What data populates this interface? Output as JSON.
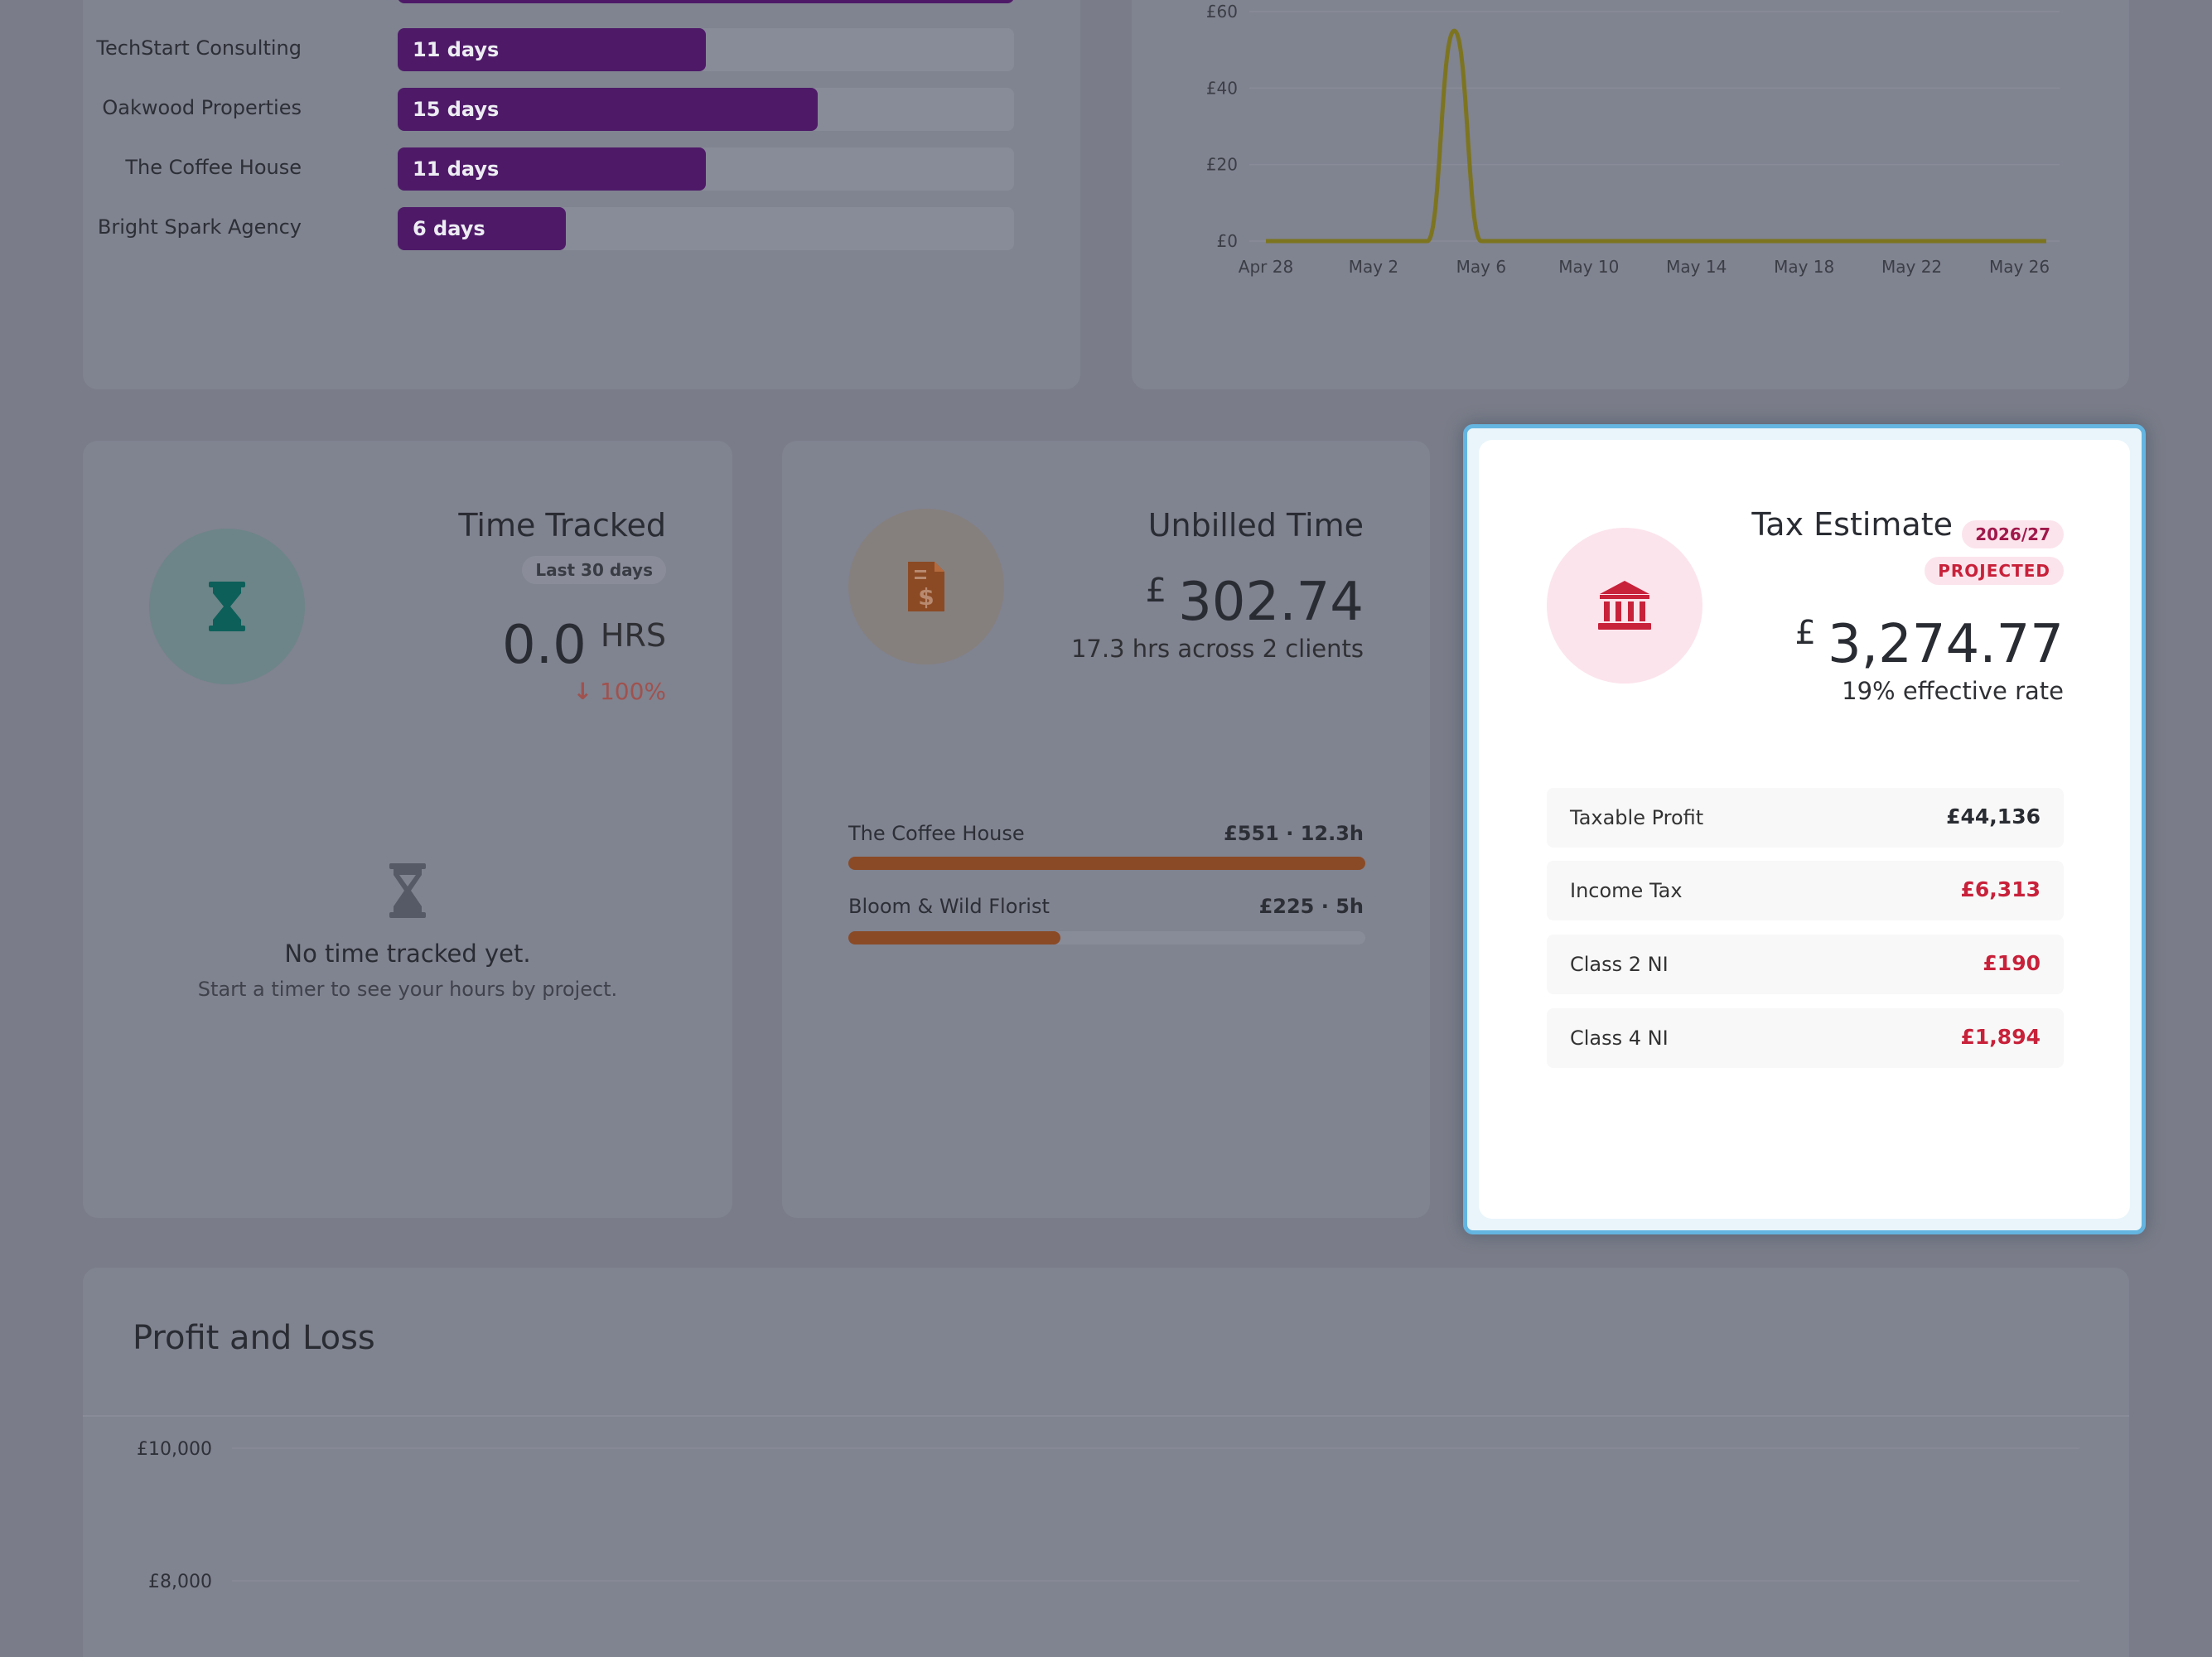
{
  "clients_card": {
    "rows": [
      {
        "name": "",
        "days_label": "",
        "days": 22
      },
      {
        "name": "TechStart Consulting",
        "days_label": "11 days",
        "days": 11
      },
      {
        "name": "Oakwood Properties",
        "days_label": "15 days",
        "days": 15
      },
      {
        "name": "The Coffee House",
        "days_label": "11 days",
        "days": 11
      },
      {
        "name": "Bright Spark Agency",
        "days_label": "6 days",
        "days": 6
      }
    ],
    "max_days": 22
  },
  "revenue_chart": {
    "chart_data": {
      "type": "line",
      "x": [
        "Apr 28",
        "Apr 29",
        "Apr 30",
        "May 1",
        "May 2",
        "May 3",
        "May 4",
        "May 5",
        "May 6",
        "May 7",
        "May 8",
        "May 9",
        "May 10",
        "May 11",
        "May 12",
        "May 13",
        "May 14",
        "May 15",
        "May 16",
        "May 17",
        "May 18",
        "May 19",
        "May 20",
        "May 21",
        "May 22",
        "May 23",
        "May 24",
        "May 25",
        "May 26",
        "May 27"
      ],
      "series": [
        {
          "values": [
            0,
            0,
            0,
            0,
            0,
            0,
            0,
            55,
            0,
            0,
            0,
            0,
            0,
            0,
            0,
            0,
            0,
            0,
            0,
            0,
            0,
            0,
            0,
            0,
            0,
            0,
            0,
            0,
            0,
            0
          ]
        }
      ],
      "x_ticks": [
        "Apr 28",
        "May 2",
        "May 6",
        "May 10",
        "May 14",
        "May 18",
        "May 22",
        "May 26"
      ],
      "y_ticks": [
        "£0",
        "£20",
        "£40",
        "£60"
      ],
      "ylim": [
        0,
        60
      ],
      "grid": true,
      "line_color": "#7d7420"
    }
  },
  "time_tracked": {
    "title": "Time Tracked",
    "period": "Last 30 days",
    "value": "0.0",
    "unit": "HRS",
    "change": "100%",
    "empty_title": "No time tracked yet.",
    "empty_sub": "Start a timer to see your hours by project.",
    "icon": "hourglass-icon"
  },
  "unbilled": {
    "title": "Unbilled Time",
    "currency": "£",
    "value": "302.74",
    "sub": "17.3 hrs across 2 clients",
    "icon": "invoice-dollar-icon",
    "clients": [
      {
        "name": "The Coffee House",
        "detail": "£551 · 12.3h",
        "fraction": 1.0
      },
      {
        "name": "Bloom & Wild Florist",
        "detail": "£225 · 5h",
        "fraction": 0.41
      }
    ]
  },
  "tax": {
    "title": "Tax Estimate",
    "year": "2026/27",
    "status": "PROJECTED",
    "currency": "£",
    "value": "3,274.77",
    "sub": "19% effective rate",
    "icon": "bank-icon",
    "rows": [
      {
        "label": "Taxable Profit",
        "value": "£44,136"
      },
      {
        "label": "Income Tax",
        "value": "£6,313"
      },
      {
        "label": "Class 2 NI",
        "value": "£190"
      },
      {
        "label": "Class 4 NI",
        "value": "£1,894"
      }
    ],
    "accent": "#c8213a"
  },
  "profit_loss": {
    "title": "Profit and Loss",
    "chart_data": {
      "type": "bar",
      "y_ticks": [
        "£10,000",
        "£8,000"
      ],
      "grid": true
    }
  }
}
